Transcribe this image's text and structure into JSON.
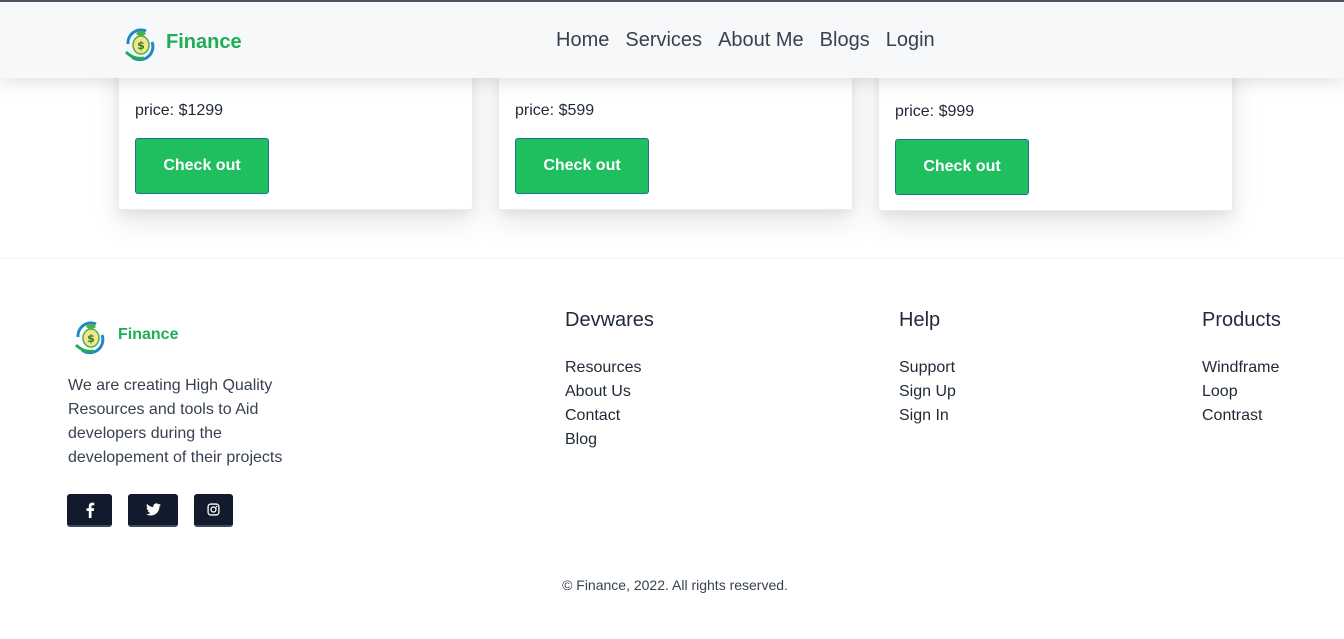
{
  "header": {
    "brand": "Finance",
    "nav": [
      "Home",
      "Services",
      "About Me",
      "Blogs",
      "Login"
    ]
  },
  "cards": [
    {
      "price": "price: $1299",
      "button": "Check out"
    },
    {
      "price": "price: $599",
      "button": "Check out"
    },
    {
      "price": "price: $999",
      "button": "Check out"
    }
  ],
  "footer": {
    "brand": "Finance",
    "description": "We are creating High Quality Resources and tools to Aid developers during the developement of their projects",
    "socials": [
      "facebook-icon",
      "twitter-icon",
      "instagram-icon"
    ],
    "columns": [
      {
        "title": "Devwares",
        "links": [
          "Resources",
          "About Us",
          "Contact",
          "Blog"
        ]
      },
      {
        "title": "Help",
        "links": [
          "Support",
          "Sign Up",
          "Sign In"
        ]
      },
      {
        "title": "Products",
        "links": [
          "Windframe",
          "Loop",
          "Contrast"
        ]
      }
    ],
    "copyright": "© Finance, 2022. All rights reserved."
  },
  "colors": {
    "brand_green": "#1fae55",
    "button_green": "#1fbf5f",
    "social_bg": "#111b2d"
  }
}
